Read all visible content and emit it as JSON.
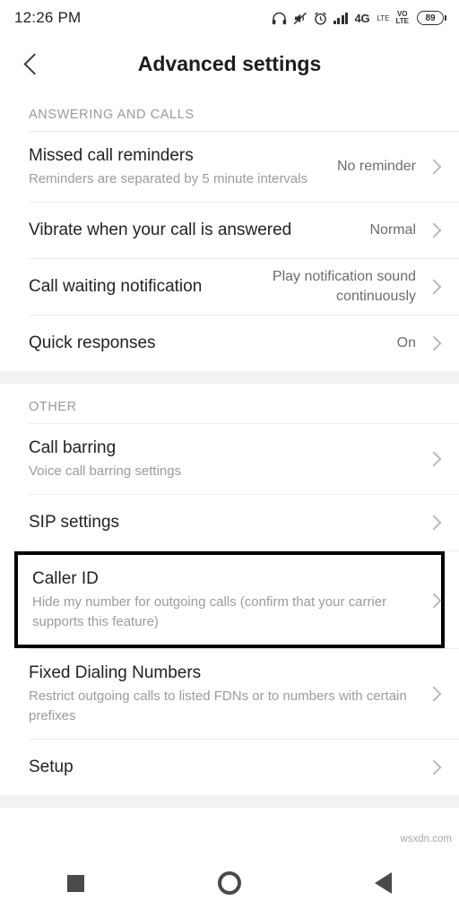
{
  "status_bar": {
    "time": "12:26 PM",
    "network_type": "4G",
    "network_sub": "LTE",
    "volte_top": "VO",
    "volte_bottom": "LTE",
    "battery_percent": "89",
    "icons": [
      "headphones-icon",
      "mute-icon",
      "alarm-icon",
      "signal-icon",
      "volte-icon",
      "battery-icon"
    ]
  },
  "header": {
    "title": "Advanced settings",
    "back_icon": "chevron-left-icon"
  },
  "sections": [
    {
      "header": "ANSWERING AND CALLS",
      "rows": [
        {
          "title": "Missed call reminders",
          "subtitle": "Reminders are separated by 5 minute intervals",
          "value": "No reminder"
        },
        {
          "title": "Vibrate when your call is answered",
          "subtitle": "",
          "value": "Normal"
        },
        {
          "title": "Call waiting notification",
          "subtitle": "",
          "value": "Play notification sound continuously"
        },
        {
          "title": "Quick responses",
          "subtitle": "",
          "value": "On"
        }
      ]
    },
    {
      "header": "OTHER",
      "rows": [
        {
          "title": "Call barring",
          "subtitle": "Voice call barring settings",
          "value": ""
        },
        {
          "title": "SIP settings",
          "subtitle": "",
          "value": ""
        },
        {
          "title": "Caller ID",
          "subtitle": "Hide my number for outgoing calls (confirm that your carrier supports this feature)",
          "value": "",
          "highlighted": true
        },
        {
          "title": "Fixed Dialing Numbers",
          "subtitle": "Restrict outgoing calls to listed FDNs or to numbers with certain prefixes",
          "value": ""
        },
        {
          "title": "Setup",
          "subtitle": "",
          "value": ""
        }
      ]
    }
  ],
  "nav_bar": {
    "recents_icon": "square-icon",
    "home_icon": "circle-icon",
    "back_icon": "triangle-back-icon"
  },
  "watermark": "wsxdn.com",
  "colors": {
    "background": "#ffffff",
    "separator": "#f2f2f2",
    "title_text": "#222222",
    "subtitle_text": "#9b9b9b",
    "value_text": "#6d6d6d",
    "highlight_border": "#000000"
  }
}
